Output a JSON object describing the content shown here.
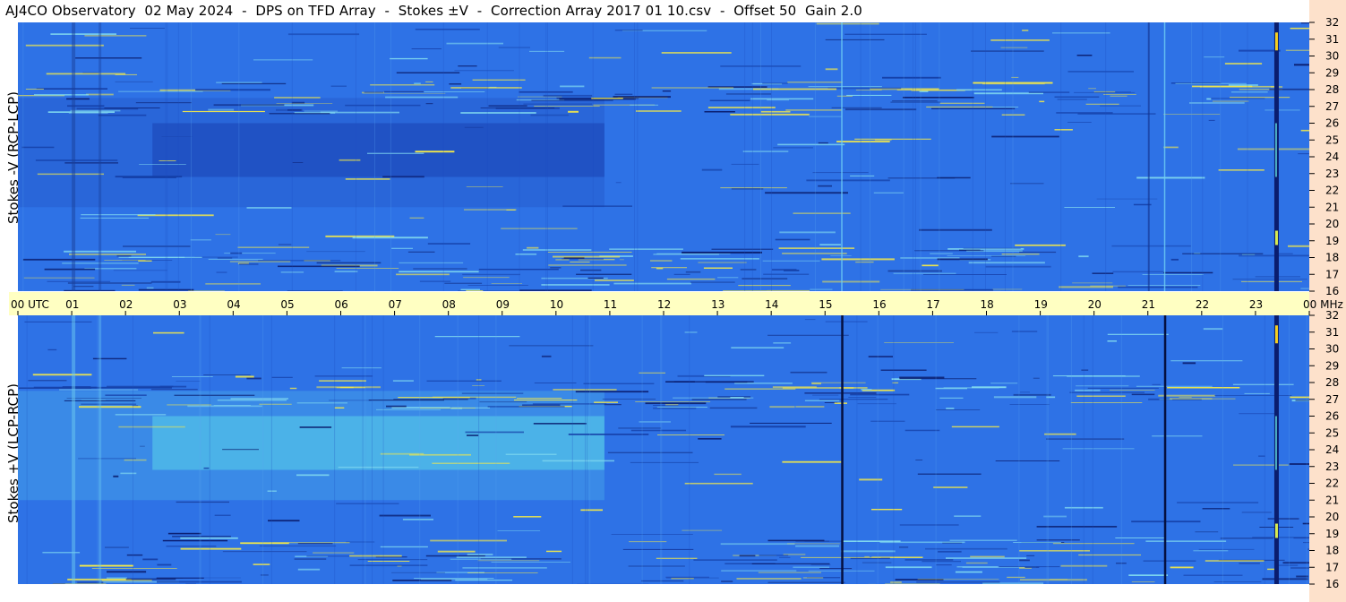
{
  "title": "AJ4CO Observatory  02 May 2024  -  DPS on TFD Array  -  Stokes ±V  -  Correction Array 2017 01 10.csv  -  Offset 50  Gain 2.0",
  "chart_data": {
    "type": "heatmap",
    "x_axis": {
      "ticks": [
        "00",
        "01",
        "02",
        "03",
        "04",
        "05",
        "06",
        "07",
        "08",
        "09",
        "10",
        "11",
        "12",
        "13",
        "14",
        "15",
        "16",
        "17",
        "18",
        "19",
        "20",
        "21",
        "22",
        "23",
        "00"
      ],
      "start_label": "00  UTC",
      "end_label": "00 MHz",
      "range_hours": [
        0,
        24
      ]
    },
    "y_axis": {
      "ticks": [
        "32",
        "31",
        "30",
        "29",
        "28",
        "27",
        "26",
        "25",
        "24",
        "23",
        "22",
        "21",
        "20",
        "19",
        "18",
        "17",
        "16"
      ],
      "range_mhz": [
        16,
        32
      ]
    },
    "panels": [
      {
        "name": "top",
        "ylabel": "Stokes -V (RCP-LCP)",
        "colors": {
          "base": "#2e72e6",
          "dark_region": "#1f4fbf",
          "noise_bright": "#f2e84a",
          "noise_dark": "#0a1d6e"
        },
        "dark_region_hours": [
          2.5,
          10.9
        ],
        "dark_region_mhz": [
          22.8,
          26.0
        ]
      },
      {
        "name": "bottom",
        "ylabel": "Stokes +V (LCP-RCP)",
        "colors": {
          "base": "#2e72e6",
          "bright_region": "#4fb8e8",
          "noise_bright": "#f2e84a",
          "noise_dark": "#0a1d6e"
        },
        "bright_region_hours": [
          2.5,
          10.9
        ],
        "bright_region_mhz": [
          22.8,
          26.0
        ]
      }
    ]
  }
}
